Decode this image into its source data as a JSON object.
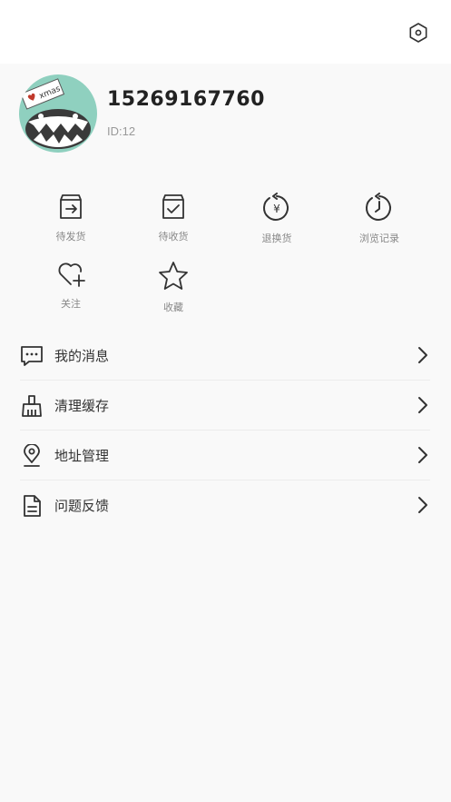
{
  "profile": {
    "phone": "15269167760",
    "id_label": "ID:12",
    "avatar_tag": "xmas"
  },
  "orders": [
    {
      "label": "待发货",
      "icon": "ship-box-icon"
    },
    {
      "label": "待收货",
      "icon": "receive-box-icon"
    },
    {
      "label": "退换货",
      "icon": "refund-icon"
    },
    {
      "label": "浏览记录",
      "icon": "history-icon"
    },
    {
      "label": "关注",
      "icon": "heart-plus-icon"
    },
    {
      "label": "收藏",
      "icon": "star-icon"
    }
  ],
  "menu": [
    {
      "label": "我的消息",
      "icon": "message-icon"
    },
    {
      "label": "清理缓存",
      "icon": "broom-icon"
    },
    {
      "label": "地址管理",
      "icon": "location-icon"
    },
    {
      "label": "问题反馈",
      "icon": "document-icon"
    }
  ],
  "colors": {
    "background": "#f9f9f9",
    "avatar_bg": "#8fd0bf",
    "icon": "#333333"
  }
}
